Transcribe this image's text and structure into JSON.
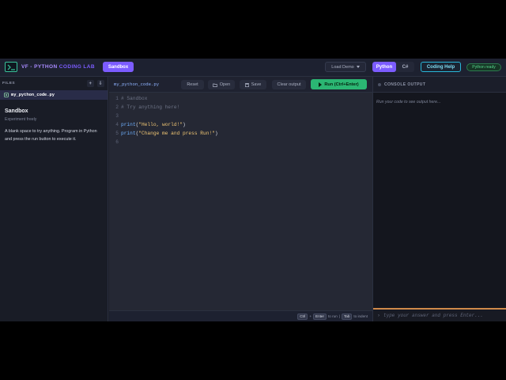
{
  "header": {
    "title_prefix": "VF - PYTHON",
    "title_suffix": "CODING LAB",
    "mode_pill": "Sandbox",
    "load_demo": "Load Demo",
    "languages": [
      "Python",
      "C#"
    ],
    "active_language": "Python",
    "help_label": "Coding Help",
    "status": "Python ready"
  },
  "sidebar": {
    "heading": "FILES",
    "add_label": "+",
    "upload_label": "⇩",
    "file_name": "my_python_code.py",
    "lesson_title": "Sandbox",
    "lesson_subtitle": "Experiment freely",
    "lesson_description": "A blank space to try anything. Program in Python and press the run button to execute it."
  },
  "editor": {
    "tab_name": "my_python_code.py",
    "reset_label": "Reset",
    "open_label": "Open",
    "save_label": "Save",
    "clear_label": "Clear output",
    "run_label": "Run (Ctrl+Enter)",
    "line_numbers": [
      "1",
      "2",
      "3",
      "4",
      "5",
      "6"
    ],
    "lines": {
      "l1": "# Sandbox",
      "l2": "# Try anything here!",
      "l4_fn": "print",
      "l4_open": "(",
      "l4_str": "\"Hello, world!\"",
      "l4_close": ")",
      "l5_fn": "print",
      "l5_open": "(",
      "l5_str": "\"Change me and press Run!\"",
      "l5_close": ")"
    },
    "footer": {
      "key1": "Ctrl",
      "plus": "+",
      "key2": "Enter",
      "to_run": "to run",
      "sep": "|",
      "key3": "Tab",
      "to_indent": "to indent"
    }
  },
  "console": {
    "heading": "CONSOLE OUTPUT",
    "placeholder_output": "Run your code to see output here...",
    "input_placeholder": "type your answer and press Enter...",
    "prompt": "›"
  },
  "colors": {
    "accent": "#7c5cff",
    "run": "#2bb673",
    "help": "#29b6d8",
    "status": "#56d78e",
    "console_border": "#d08a4a"
  }
}
